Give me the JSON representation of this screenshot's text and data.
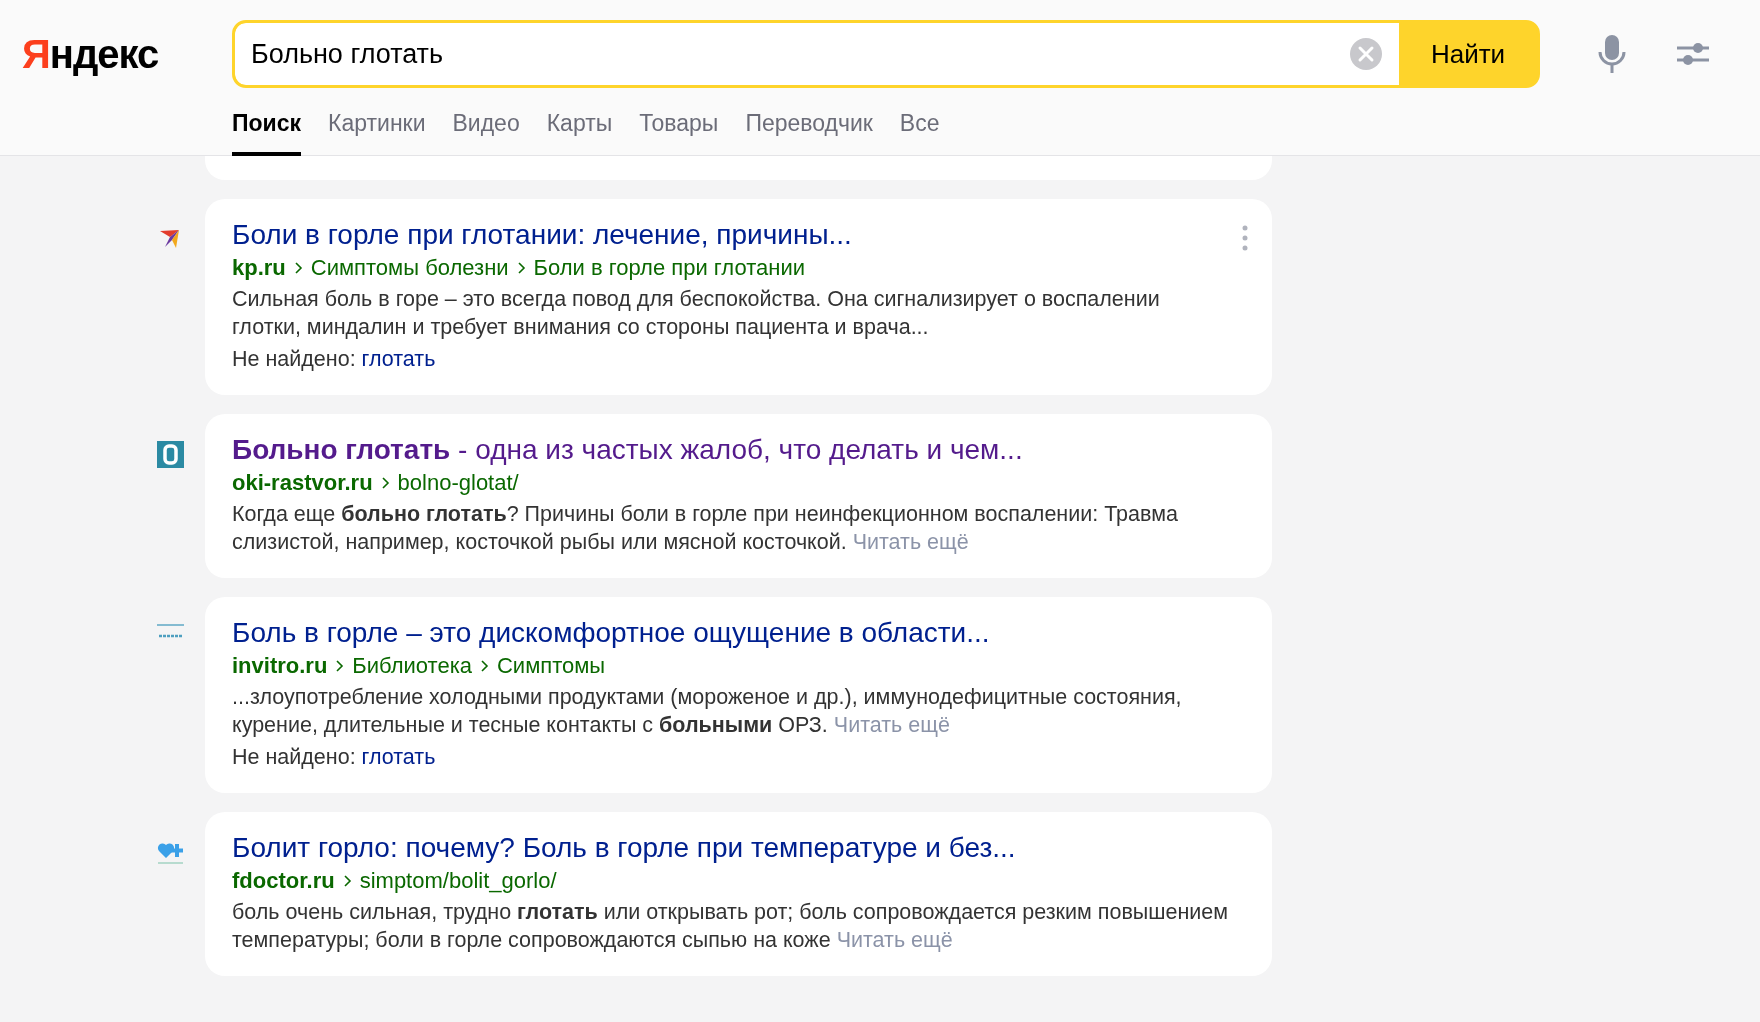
{
  "header": {
    "logo": "Яндекс",
    "search": {
      "value": "Больно глотать",
      "button": "Найти"
    },
    "tabs": [
      {
        "label": "Поиск",
        "selected": true
      },
      {
        "label": "Картинки",
        "selected": false
      },
      {
        "label": "Видео",
        "selected": false
      },
      {
        "label": "Карты",
        "selected": false
      },
      {
        "label": "Товары",
        "selected": false
      },
      {
        "label": "Переводчик",
        "selected": false
      },
      {
        "label": "Все",
        "selected": false
      }
    ]
  },
  "results": [
    {
      "kind": "bird",
      "title": "Боли в горле при глотании: лечение, причины...",
      "visited": false,
      "has_menu": true,
      "domain": "kp.ru",
      "path": [
        "Симптомы болезни",
        "Боли в горле при глотании"
      ],
      "snippet": "Сильная боль в горе – это всегда повод для беспокойства. Она сигнализирует о воспалении глотки, миндалин и требует внимания со стороны пациента и врача...",
      "not_found": {
        "label": "Не найдено:",
        "word": "глотать"
      }
    },
    {
      "kind": "digit",
      "title": "**Больно глотать** - одна из частых жалоб, что делать и чем...",
      "visited": true,
      "has_menu": false,
      "domain": "oki-rastvor.ru",
      "path": [
        "bolno-glotat/"
      ],
      "snippet": "Когда еще **больно глотать**? Причины боли в горле при неинфекционном воспалении: Травма слизистой, например, косточкой рыбы или мясной косточкой.",
      "read_more": "Читать ещё"
    },
    {
      "kind": "line",
      "title": "Боль в горле – это дискомфортное ощущение в области...",
      "visited": false,
      "has_menu": false,
      "domain": "invitro.ru",
      "path": [
        "Библиотека",
        "Симптомы"
      ],
      "snippet": "...злоупотребление холодными продуктами (мороженое и др.), иммунодефицитные состояния, курение, длительные и тесные контакты с **больными** ОРЗ.",
      "read_more": "Читать ещё",
      "not_found": {
        "label": "Не найдено:",
        "word": "глотать"
      }
    },
    {
      "kind": "heart",
      "title": "Болит горло: почему? Боль в горле при температуре и без...",
      "visited": false,
      "has_menu": false,
      "domain": "fdoctor.ru",
      "path": [
        "simptom/bolit_gorlo/"
      ],
      "snippet": "боль очень сильная, трудно **глотать** или открывать рот; боль сопровождается резким повышением температуры; боли в горле сопровождаются сыпью на коже",
      "read_more": "Читать ещё"
    }
  ]
}
